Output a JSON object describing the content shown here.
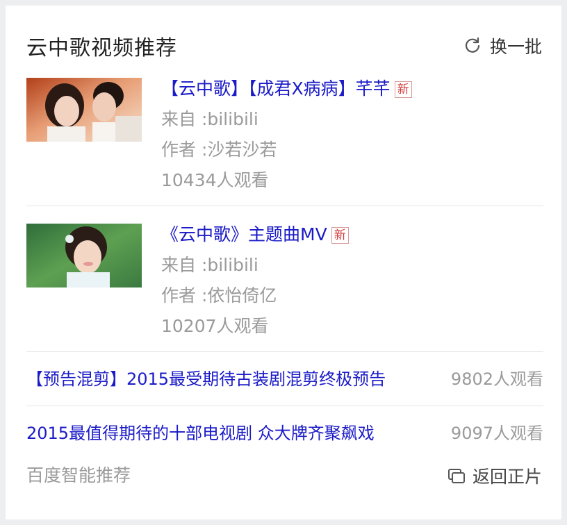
{
  "header": {
    "title": "云中歌视频推荐",
    "refresh_label": "换一批"
  },
  "videos": [
    {
      "title": "【云中歌】【成君X病病】芊芊",
      "badge": "新",
      "source": "来自 :bilibili",
      "author": "作者 :沙若沙若",
      "views": "10434人观看"
    },
    {
      "title": "《云中歌》主题曲MV",
      "badge": "新",
      "source": "来自 :bilibili",
      "author": "作者 :依怡倚亿",
      "views": "10207人观看"
    }
  ],
  "links": [
    {
      "title": "【预告混剪】2015最受期待古装剧混剪终极预告",
      "views": "9802人观看"
    },
    {
      "title": "2015最值得期待的十部电视剧 众大牌齐聚飙戏",
      "views": "9097人观看"
    }
  ],
  "footer": {
    "label": "百度智能推荐",
    "back_label": "返回正片"
  },
  "colors": {
    "link": "#1b1bc8",
    "muted": "#9a9a9a",
    "badge": "#d43b3b"
  }
}
